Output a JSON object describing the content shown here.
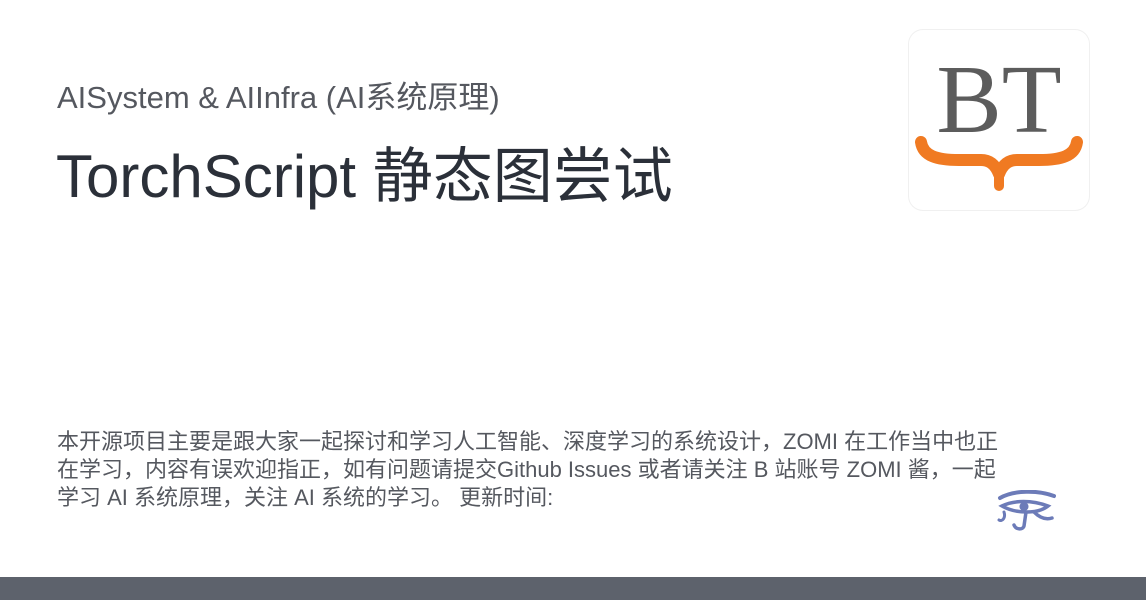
{
  "header": {
    "site_title": "AISystem & AIInfra (AI系统原理)",
    "page_title": "TorchScript 静态图尝试"
  },
  "logo": {
    "letters": "BT",
    "letter_color": "#5c5c5c",
    "brace_color": "#f07a22",
    "icon": "book-brace-logo"
  },
  "description": "本开源项目主要是跟大家一起探讨和学习人工智能、深度学习的系统设计，ZOMI 在工作当中也正在学习，内容有误欢迎指正，如有问题请提交Github Issues 或者请关注 B 站账号 ZOMI 酱，一起学习 AI 系统原理，关注 AI 系统的学习。 更新时间:",
  "footer": {
    "color": "#5d626c"
  },
  "decor": {
    "eye_icon": "eye-of-horus-icon",
    "eye_color": "#6c7bb8"
  }
}
